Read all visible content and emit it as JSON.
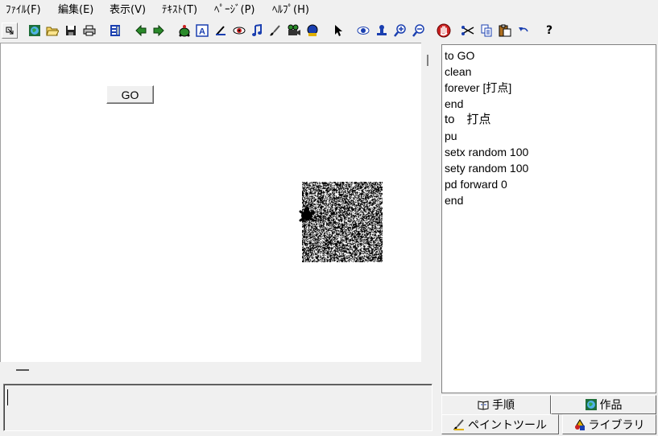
{
  "menu": [
    {
      "label": "ﾌｧｲﾙ(F)",
      "name": "menu-file"
    },
    {
      "label": "編集(E)",
      "name": "menu-edit"
    },
    {
      "label": "表示(V)",
      "name": "menu-view"
    },
    {
      "label": "ﾃｷｽﾄ(T)",
      "name": "menu-text"
    },
    {
      "label": "ﾍﾟｰｼﾞ(P)",
      "name": "menu-page"
    },
    {
      "label": "ﾍﾙﾌﾟ(H)",
      "name": "menu-help"
    }
  ],
  "toolbar": {
    "icons": [
      "restore-icon",
      "globe-icon",
      "open-folder-icon",
      "save-disk-icon",
      "print-icon",
      "slide-icon",
      "back-arrow-icon",
      "forward-arrow-icon",
      "turtle-icon",
      "textbox-icon",
      "pen-icon",
      "eye-icon",
      "music-note-icon",
      "paintbrush-icon",
      "camera-icon",
      "robot-icon",
      "pointer-arrow-icon",
      "look-eye-icon",
      "stamp-icon",
      "zoom-in-icon",
      "zoom-out-icon",
      "stop-hand-icon",
      "cut-scissors-icon",
      "copy-icon",
      "paste-icon",
      "undo-icon",
      "help-question-icon"
    ],
    "help_label": "?",
    "text_tool_label": "A"
  },
  "canvas": {
    "go_button_label": "GO"
  },
  "procedures": {
    "lines": [
      "to GO",
      "clean",
      "forever [打点]",
      "end",
      "to　打点",
      "pu",
      "setx random 100",
      "sety random 100",
      "pd forward 0",
      "end"
    ]
  },
  "tabs": {
    "procedures": "手順",
    "projects": "作品",
    "paint_tool": "ペイントツール",
    "library": "ライブラリ"
  },
  "colors": {
    "window_bg": "#f0f0f0",
    "canvas_bg": "#ffffff",
    "accent_green": "#2a8a2a",
    "accent_blue": "#1a3fb0",
    "accent_red": "#cc2222"
  }
}
